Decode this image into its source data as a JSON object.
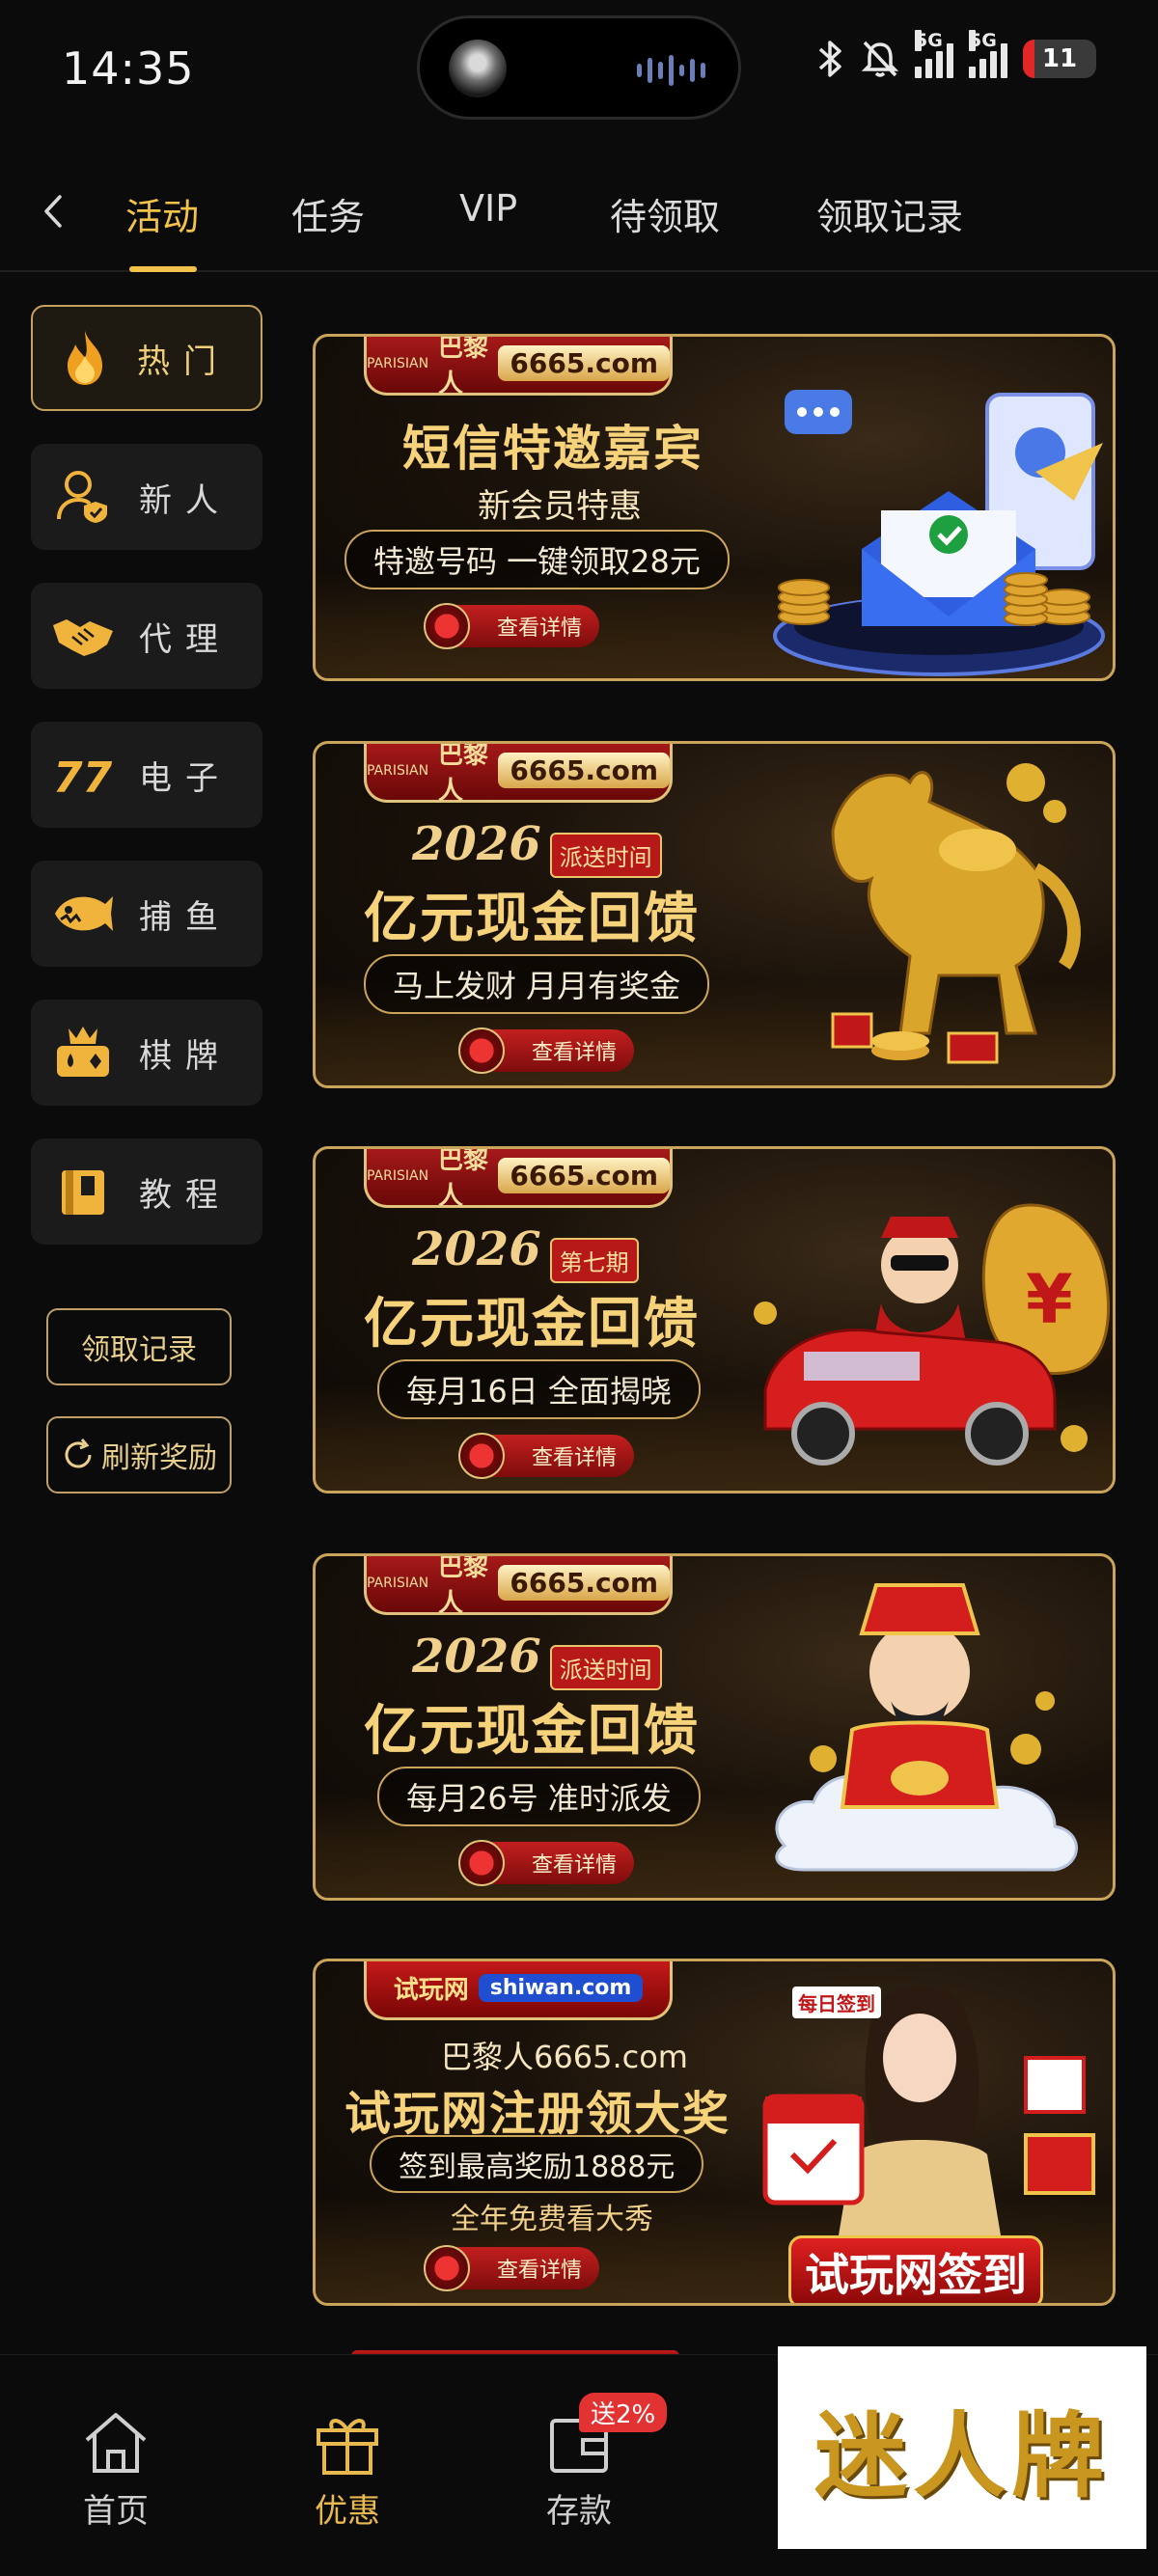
{
  "status_bar": {
    "time": "14:35",
    "network_1": "5G",
    "network_2": "5G",
    "battery": "11"
  },
  "top_tabs": [
    {
      "label": "活动",
      "active": true
    },
    {
      "label": "任务",
      "active": false
    },
    {
      "label": "VIP",
      "active": false
    },
    {
      "label": "待领取",
      "active": false
    },
    {
      "label": "领取记录",
      "active": false
    }
  ],
  "sidebar": {
    "items": [
      {
        "label": "热门",
        "icon": "flame-icon",
        "active": true
      },
      {
        "label": "新人",
        "icon": "new-user-icon",
        "active": false
      },
      {
        "label": "代理",
        "icon": "handshake-icon",
        "active": false
      },
      {
        "label": "电子",
        "icon": "slot-777-icon",
        "active": false
      },
      {
        "label": "捕鱼",
        "icon": "fish-icon",
        "active": false
      },
      {
        "label": "棋牌",
        "icon": "cards-crown-icon",
        "active": false
      },
      {
        "label": "教程",
        "icon": "book-icon",
        "active": false
      }
    ],
    "record_button": "领取记录",
    "refresh_button": "刷新奖励"
  },
  "banners": [
    {
      "brand_cn": "巴黎人",
      "brand_domain": "6665.com",
      "brand_tag": "PARISIAN",
      "title": "短信特邀嘉宾",
      "subtitle": "新会员特惠",
      "pill": "特邀号码 一键领取28元",
      "detail": "查看详情"
    },
    {
      "brand_cn": "巴黎人",
      "brand_domain": "6665.com",
      "brand_tag": "PARISIAN",
      "year": "2026",
      "badge": "派送时间",
      "title": "亿元现金回馈",
      "pill": "马上发财 月月有奖金",
      "detail": "查看详情"
    },
    {
      "brand_cn": "巴黎人",
      "brand_domain": "6665.com",
      "brand_tag": "PARISIAN",
      "year": "2026",
      "badge": "第七期",
      "title": "亿元现金回馈",
      "pill": "每月16日 全面揭晓",
      "detail": "查看详情"
    },
    {
      "brand_cn": "巴黎人",
      "brand_domain": "6665.com",
      "brand_tag": "PARISIAN",
      "year": "2026",
      "badge": "派送时间",
      "title": "亿元现金回馈",
      "pill": "每月26号 准时派发",
      "detail": "查看详情"
    },
    {
      "brand_cn": "试玩网",
      "brand_domain": "shiwan.com",
      "subtitle": "巴黎人6665.com",
      "title": "试玩网注册领大奖",
      "pill": "签到最高奖励1888元",
      "extra": "全年免费看大秀",
      "art_badge": "试玩网签到",
      "art_calendar": "每日签到",
      "detail": "查看详情"
    }
  ],
  "bottom_nav": [
    {
      "label": "首页",
      "icon": "home-icon",
      "active": false
    },
    {
      "label": "优惠",
      "icon": "gift-icon",
      "active": true
    },
    {
      "label": "存款",
      "icon": "wallet-icon",
      "active": false
    }
  ],
  "deposit_badge": "送2%",
  "watermark": "迷人牌",
  "colors": {
    "accent": "#f2c24a",
    "background": "#0b0b0b",
    "sidebar_item": "#1b1b1b",
    "banner_border": "#c9a45a"
  }
}
